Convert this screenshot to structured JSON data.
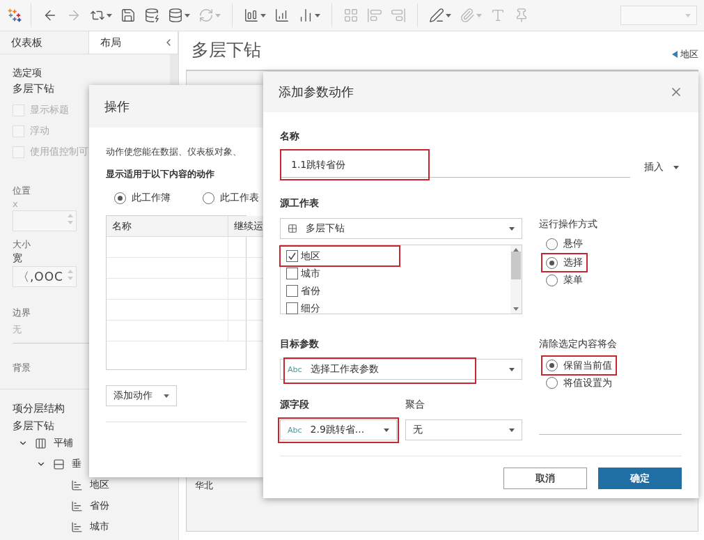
{
  "left_panel": {
    "tabs": [
      {
        "label": "仪表板",
        "selected": false
      },
      {
        "label": "布局",
        "selected": true
      }
    ],
    "selected_item": {
      "heading": "选定项",
      "name": "多层下钻"
    },
    "options": [
      {
        "label": "显示标题",
        "checked": false,
        "disabled": true
      },
      {
        "label": "浮动",
        "checked": false,
        "disabled": true
      },
      {
        "label": "使用值控制可",
        "checked": false,
        "disabled": true
      }
    ],
    "position": {
      "heading": "位置",
      "fields": [
        {
          "label": "x"
        }
      ]
    },
    "size": {
      "heading": "大小",
      "fields": [
        {
          "label": "宽",
          "value": "〈,OOC"
        }
      ]
    },
    "border": {
      "heading": "边界",
      "value": "无"
    },
    "background": {
      "heading": "背景"
    },
    "hierarchy": {
      "title": "项分层结构",
      "root": "多层下钻",
      "items": [
        {
          "label": "平铺",
          "kind": "tiled",
          "expanded": true,
          "children": [
            {
              "label": "垂",
              "kind": "vertical",
              "expanded": true,
              "children": [
                {
                  "label": "地区",
                  "kind": "sheet"
                },
                {
                  "label": "省份",
                  "kind": "sheet"
                },
                {
                  "label": "城市",
                  "kind": "sheet"
                }
              ]
            }
          ]
        }
      ]
    }
  },
  "canvas": {
    "title": "多层下钻",
    "legend": "地区",
    "row_label": "华北"
  },
  "actions_dialog": {
    "title": "操作",
    "description": "动作使您能在数据、仪表板对象、",
    "filter_label": "显示适用于以下内容的动作",
    "scope": [
      {
        "label": "此工作簿",
        "selected": true
      },
      {
        "label": "此工作表",
        "selected": false
      }
    ],
    "columns": [
      "名称",
      "继续运"
    ],
    "add_button": "添加动作"
  },
  "param_dialog": {
    "title": "添加参数动作",
    "name_label": "名称",
    "name_value": "1.1跳转省份",
    "name_highlighted": true,
    "insert_button": "插入",
    "source_label": "源工作表",
    "source_sheet": "多层下钻",
    "sheets": [
      {
        "label": "地区",
        "checked": true,
        "highlighted": true
      },
      {
        "label": "城市",
        "checked": false,
        "highlighted": false
      },
      {
        "label": "省份",
        "checked": false,
        "highlighted": false
      },
      {
        "label": "细分",
        "checked": false,
        "highlighted": false
      }
    ],
    "run_label": "运行操作方式",
    "run_modes": [
      {
        "label": "悬停",
        "selected": false,
        "highlighted": false
      },
      {
        "label": "选择",
        "selected": true,
        "highlighted": true
      },
      {
        "label": "菜单",
        "selected": false,
        "highlighted": false
      }
    ],
    "target_label": "目标参数",
    "target": {
      "type": "Abc",
      "value": "选择工作表参数",
      "highlighted": true
    },
    "clear_label": "清除选定内容将会",
    "clear_modes": [
      {
        "label": "保留当前值",
        "selected": true,
        "highlighted": true
      },
      {
        "label": "将值设置为",
        "selected": false,
        "highlighted": false
      }
    ],
    "field_label": "源字段",
    "field": {
      "type": "Abc",
      "value": "2.9跳转省...",
      "highlighted": true
    },
    "agg_label": "聚合",
    "agg_value": "无",
    "buttons": [
      {
        "label": "取消",
        "kind": "secondary"
      },
      {
        "label": "确定",
        "kind": "primary"
      }
    ]
  }
}
